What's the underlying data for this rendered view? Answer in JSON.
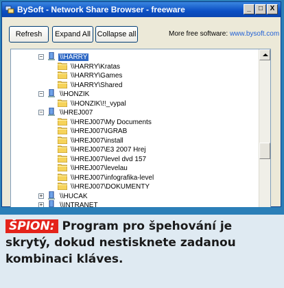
{
  "window": {
    "title": "BySoft - Network Share Browser - freeware",
    "minimize_label": "_",
    "maximize_label": "□",
    "close_label": "X"
  },
  "toolbar": {
    "refresh_label": "Refresh",
    "expand_all_label": "Expand All",
    "collapse_all_label": "Collapse all",
    "more_label": "More free software:",
    "more_link": "www.bysoft.com"
  },
  "tree": {
    "items": [
      {
        "label": "\\\\HARRY",
        "icon": "computer-icon",
        "level": 0,
        "expander": "−",
        "selected": true
      },
      {
        "label": "\\\\HARRY\\Kratas",
        "icon": "folder-icon",
        "level": 1
      },
      {
        "label": "\\\\HARRY\\Games",
        "icon": "folder-icon",
        "level": 1
      },
      {
        "label": "\\\\HARRY\\Shared",
        "icon": "folder-icon",
        "level": 1
      },
      {
        "label": "\\\\HONZIK",
        "icon": "computer-icon",
        "level": 0,
        "expander": "−"
      },
      {
        "label": "\\\\HONZIK\\!!_vypal",
        "icon": "folder-icon",
        "level": 1
      },
      {
        "label": "\\\\HREJ007",
        "icon": "computer-icon",
        "level": 0,
        "expander": "−"
      },
      {
        "label": "\\\\HREJ007\\My Documents",
        "icon": "folder-icon",
        "level": 1
      },
      {
        "label": "\\\\HREJ007\\IGRAB",
        "icon": "folder-icon",
        "level": 1
      },
      {
        "label": "\\\\HREJ007\\install",
        "icon": "folder-icon",
        "level": 1
      },
      {
        "label": "\\\\HREJ007\\E3 2007 Hrej",
        "icon": "folder-icon",
        "level": 1
      },
      {
        "label": "\\\\HREJ007\\level dvd 157",
        "icon": "folder-icon",
        "level": 1
      },
      {
        "label": "\\\\HREJ007\\levelau",
        "icon": "folder-icon",
        "level": 1
      },
      {
        "label": "\\\\HREJ007\\infografika-level",
        "icon": "folder-icon",
        "level": 1
      },
      {
        "label": "\\\\HREJ007\\DOKUMENTY",
        "icon": "folder-icon",
        "level": 1
      },
      {
        "label": "\\\\HUCAK",
        "icon": "computer-icon",
        "level": 0,
        "expander": "+"
      },
      {
        "label": "\\\\INTRANET",
        "icon": "computer-icon",
        "level": 0,
        "expander": "+"
      }
    ]
  },
  "caption": {
    "tag": "ŠPION:",
    "text": "Program pro špehování je skrytý, dokud nestisknete zadanou kombinaci kláves."
  },
  "colors": {
    "selection": "#316ac5",
    "tag_bg": "#e4231b",
    "link": "#1f5fd6",
    "caption_bg": "#dfeaf2"
  }
}
